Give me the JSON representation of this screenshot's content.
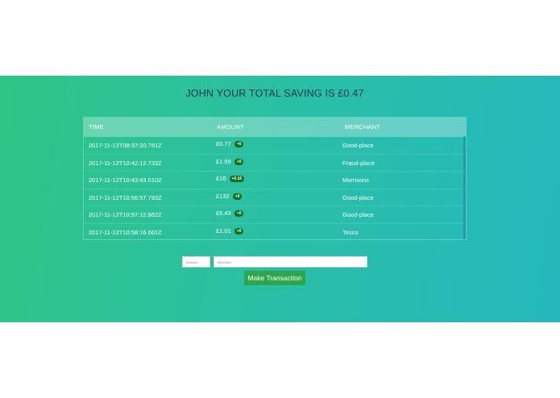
{
  "heading": "JOHN YOUR TOTAL SAVING IS £0.47",
  "table": {
    "headers": [
      "TIME",
      "AMOUNT",
      "MERCHANT"
    ],
    "rows": [
      {
        "time": "2017-11-12T08:37:20.781Z",
        "amount": "£0.77",
        "saving": "+0",
        "merchant": "Good-place"
      },
      {
        "time": "2017-11-12T10:42:12.733Z",
        "amount": "£1.99",
        "saving": "+0",
        "merchant": "Fraud-place"
      },
      {
        "time": "2017-11-12T10:43:43.510Z",
        "amount": "£10",
        "saving": "+0.16",
        "merchant": "Morrisons"
      },
      {
        "time": "2017-11-12T10:56:57.793Z",
        "amount": "£132",
        "saving": "+0",
        "merchant": "Good-place"
      },
      {
        "time": "2017-11-12T10:57:12.862Z",
        "amount": "£5.43",
        "saving": "+0",
        "merchant": "Good-place"
      },
      {
        "time": "2017-11-12T10:58:16.661Z",
        "amount": "£1.01",
        "saving": "+0",
        "merchant": "Tesco"
      }
    ]
  },
  "form": {
    "amount_placeholder": "Amount",
    "merchant_placeholder": "Merchant",
    "submit_label": "Make Transaction"
  },
  "colors": {
    "panel_gradient_start": "#2ec585",
    "panel_gradient_end": "#24b8bd",
    "badge": "#12701d",
    "button": "#2fa64a",
    "heading": "#14394a"
  }
}
